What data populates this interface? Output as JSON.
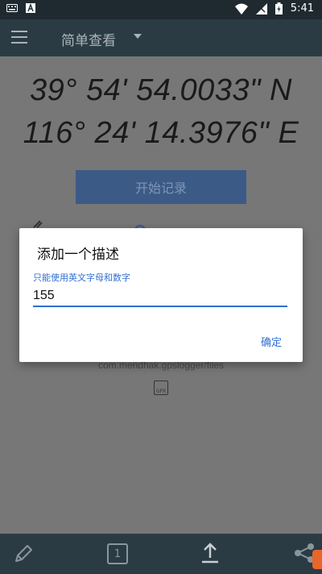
{
  "statusbar": {
    "time": "5:41",
    "left_icons": [
      "keyboard-icon",
      "a-icon"
    ],
    "right_icons": [
      "wifi-icon",
      "signal-icon",
      "battery-icon"
    ]
  },
  "appbar": {
    "title": "简单查看",
    "menu_icon": "hamburger-icon",
    "dropdown_icon": "caret-down-icon"
  },
  "coordinates": {
    "latitude": "39° 54' 54.0033\" N",
    "longitude": "116° 24' 14.3976\" E"
  },
  "main": {
    "start_button_label": "开始记录",
    "path_text": "com.mendhak.gpslogger/files",
    "gpx_icon_label": "GPX"
  },
  "dialog": {
    "title": "添加一个描述",
    "hint": "只能使用英文字母和数字",
    "input_value": "155",
    "ok_label": "确定"
  },
  "bottombar": {
    "page_number": "1",
    "icons": [
      "pencil-icon",
      "page-icon",
      "upload-icon",
      "share-icon"
    ]
  },
  "colors": {
    "statusbar_bg": "#1e2a30",
    "appbar_bg": "#2b3b44",
    "accent": "#2f6fd1",
    "button_bg": "#3c5a86"
  }
}
